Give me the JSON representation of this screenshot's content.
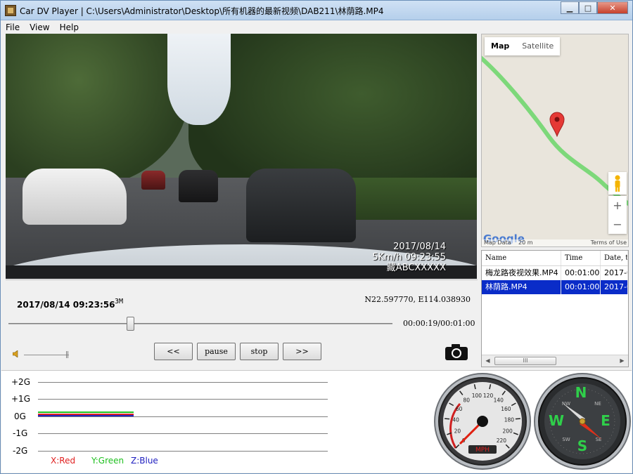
{
  "window": {
    "title": "Car DV Player | C:\\Users\\Administrator\\Desktop\\所有机器的最新视频\\DAB211\\林荫路.MP4",
    "minimize": "▁",
    "maximize": "□",
    "close": "✕"
  },
  "menu": {
    "items": [
      "File",
      "View",
      "Help"
    ]
  },
  "video": {
    "osd_date": "2017/08/14",
    "osd_speed_time": "5Km/h 09:23:55",
    "osd_plate": "藏ABCXXXXX"
  },
  "info": {
    "datetime": "2017/08/14 09:23:56",
    "resolution": "3M",
    "gps": "N22.597770, E114.038930"
  },
  "playback": {
    "time": "00:00:19/00:01:00",
    "progress_fraction": 0.317,
    "buttons": {
      "prev": "<<",
      "pause": "pause",
      "stop": "stop",
      "next": ">>"
    }
  },
  "map": {
    "tabs": [
      "Map",
      "Satellite"
    ],
    "active_tab": "Map",
    "zoom_in": "+",
    "zoom_out": "−",
    "logo": "Google",
    "footer_left": "Map Data",
    "footer_scale": "20 m",
    "footer_right": "Terms of Use",
    "route_color": "#7dd87a",
    "marker_color": "#e53935"
  },
  "filelist": {
    "columns": [
      "Name",
      "Time",
      "Date, t"
    ],
    "rows": [
      {
        "name": "梅龙路夜视效果.MP4",
        "time": "00:01:00",
        "date": "2017-0",
        "selected": false
      },
      {
        "name": "林荫路.MP4",
        "time": "00:01:00",
        "date": "2017-0",
        "selected": true
      }
    ],
    "scroll_thumb": "III"
  },
  "gsensor": {
    "labels": [
      "+2G",
      "+1G",
      "0G",
      "-1G",
      "-2G"
    ],
    "axes": {
      "x": "X:Red",
      "y": "Y:Green",
      "z": "Z:Blue"
    },
    "colors": {
      "x": "#e02020",
      "y": "#20c020",
      "z": "#2020c0"
    }
  },
  "speedometer": {
    "unit": "MPH",
    "ticks": [
      "0",
      "20",
      "40",
      "60",
      "80",
      "100",
      "120",
      "140",
      "160",
      "180",
      "200",
      "220"
    ],
    "value_mph": 0
  },
  "compass": {
    "letters": {
      "n": "N",
      "e": "E",
      "s": "S",
      "w": "W"
    },
    "minor": {
      "ne": "NE",
      "se": "SE",
      "sw": "SW",
      "nw": "NW"
    }
  }
}
